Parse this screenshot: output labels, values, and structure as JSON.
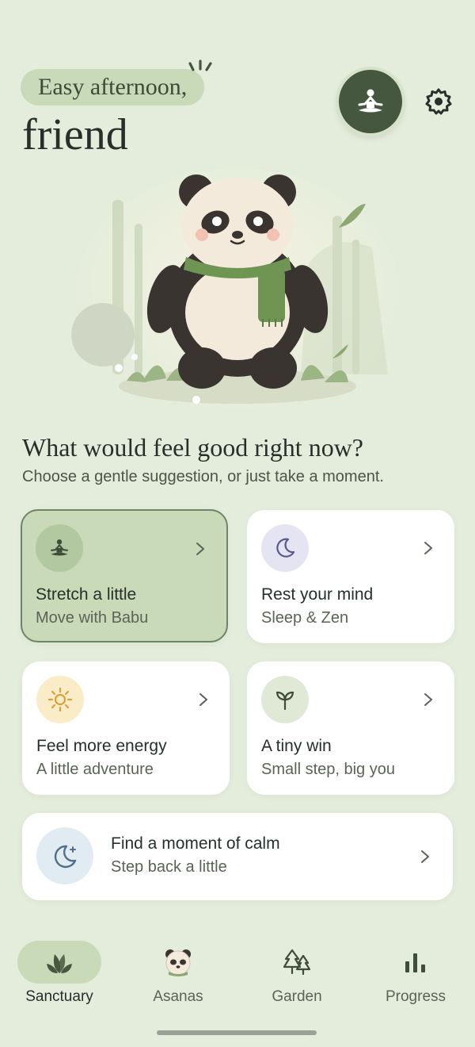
{
  "header": {
    "greeting": "Easy afternoon,",
    "name": "friend"
  },
  "prompt": {
    "title": "What would feel good right now?",
    "subtitle": "Choose a gentle suggestion, or just take a moment."
  },
  "suggestions": [
    {
      "title": "Stretch a little",
      "subtitle": "Move with Babu",
      "icon": "meditation-icon",
      "selected": true
    },
    {
      "title": "Rest your mind",
      "subtitle": "Sleep & Zen",
      "icon": "moon-icon",
      "selected": false
    },
    {
      "title": "Feel more energy",
      "subtitle": "A little adventure",
      "icon": "sun-icon",
      "selected": false
    },
    {
      "title": "A tiny win",
      "subtitle": "Small step, big you",
      "icon": "sprout-icon",
      "selected": false
    }
  ],
  "calm_card": {
    "title": "Find a moment of calm",
    "subtitle": "Step back a little",
    "icon": "moon-stars-icon"
  },
  "nav": [
    {
      "label": "Sanctuary",
      "icon": "leaves-icon",
      "active": true
    },
    {
      "label": "Asanas",
      "icon": "panda-icon",
      "active": false
    },
    {
      "label": "Garden",
      "icon": "trees-icon",
      "active": false
    },
    {
      "label": "Progress",
      "icon": "bar-chart-icon",
      "active": false
    }
  ],
  "colors": {
    "background": "#e4ecdb",
    "accent_soft": "#c9dab8",
    "accent_dark": "#46573f",
    "card": "#ffffff"
  }
}
